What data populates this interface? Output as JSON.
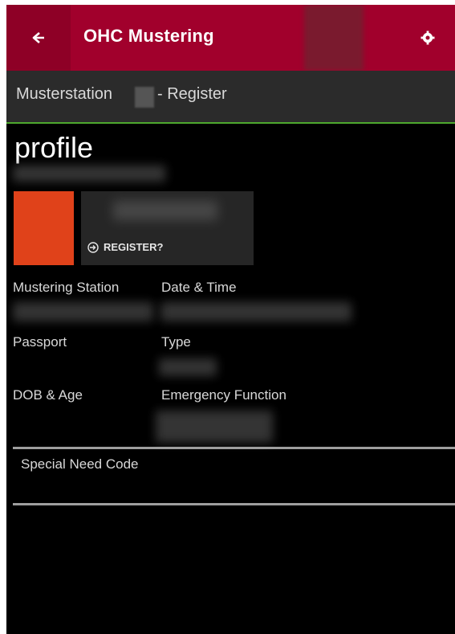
{
  "header": {
    "title": "OHC Mustering",
    "back_icon": "back-arrow-icon",
    "settings_icon": "gear-icon",
    "bg_color": "#a1002c"
  },
  "subheader": {
    "left_text": "Musterstation",
    "right_text": "- Register"
  },
  "profile": {
    "heading": "profile",
    "register_label": "REGISTER?",
    "register_icon": "login-icon",
    "avatar_color": "#e0421a"
  },
  "fields": {
    "mustering_station": "Mustering Station",
    "date_time": "Date & Time",
    "passport": "Passport",
    "type": "Type",
    "dob_age": "DOB & Age",
    "emergency_function": "Emergency Function",
    "special_need_code": "Special Need Code"
  }
}
